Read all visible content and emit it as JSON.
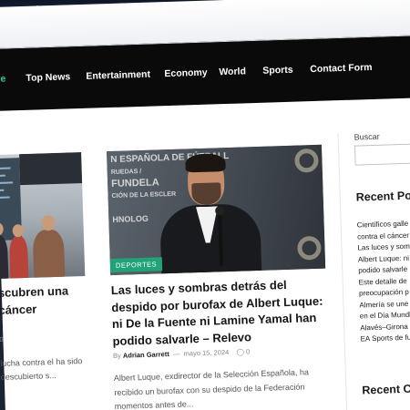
{
  "nav": {
    "items": [
      {
        "label": "e",
        "active": true
      },
      {
        "label": "Top News"
      },
      {
        "label": "Entertainment"
      },
      {
        "label": "Economy"
      },
      {
        "label": "World"
      },
      {
        "label": "Sports"
      },
      {
        "label": "Contact Form"
      }
    ]
  },
  "left_card": {
    "title": "scubren una cáncer",
    "meta": "0",
    "excerpt": "lucha contra el ha sido descubierto s..."
  },
  "hero_card": {
    "banner_lines": [
      "N ESPAÑOLA DE FÚTBALL",
      "RUEDAS /",
      "FUNDELA",
      "CIÓN DE LA ESCLER",
      "HNOLOG"
    ],
    "category": "DEPORTES",
    "title": "Las luces y sombras detrás del despido por burofax de Albert Luque: ni De la Fuente ni Lamine Yamal han podido salvarle – Relevo",
    "by_label": "By",
    "author": "Adrian Garrett",
    "date": "mayo 15, 2024",
    "comments": "0",
    "excerpt": "Albert Luque, exdirector de la Selección Española, ha recibido un burofax con su despido de la Federación momentos antes de..."
  },
  "sidebar": {
    "search_label": "Buscar",
    "search_value": "",
    "recent_posts_title": "Recent Po",
    "recent_posts": [
      "Científicos galle",
      "contra el cáncer",
      "Las luces y somb",
      "Albert Luque: ni",
      "podido salvarle",
      "Este detalle de",
      "preocupación p",
      "Almería se une",
      "en el Día Mundi",
      "Alavés–Girona",
      "EA Sports de fu"
    ],
    "recent_comments_title": "Recent C"
  },
  "colors": {
    "nav_bg": "#0a0a0a",
    "accent": "#2ec4a0",
    "badge": "#21a37a"
  }
}
